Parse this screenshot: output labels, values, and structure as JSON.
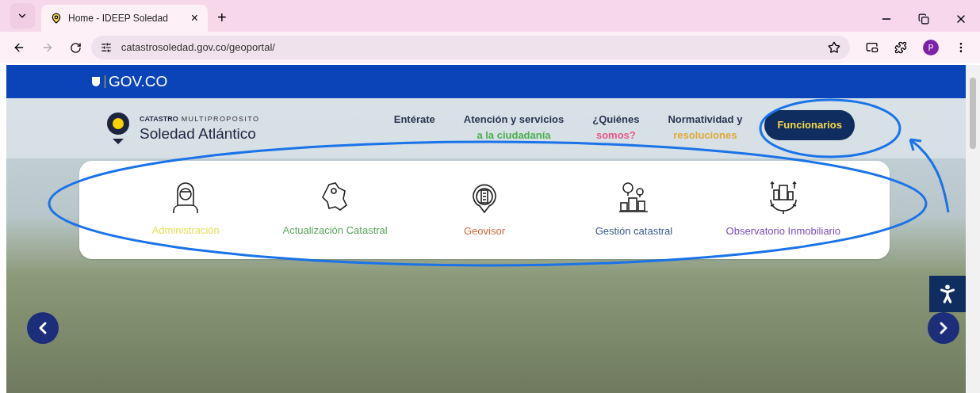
{
  "browser": {
    "tab_title": "Home - IDEEP Soledad",
    "tab_close": "×",
    "new_tab": "+",
    "url": "catastrosoledad.gov.co/geoportal/",
    "profile_initial": "P"
  },
  "gov_bar": {
    "label": "GOV.CO"
  },
  "header": {
    "brand_top_bold": "CATASTRO",
    "brand_top_light": "MULTIPROPOSITO",
    "brand_name": "Soledad Atlántico",
    "nav": [
      {
        "label": "Entérate"
      },
      {
        "label": "Atención y servicios",
        "sublabel": "a la ciudadanía",
        "color": "#4caf50"
      },
      {
        "label": "¿Quiénes",
        "sublabel": "somos?",
        "color": "#e8588a"
      },
      {
        "label": "Normatividad y",
        "sublabel": "resoluciones",
        "color": "#e0a93a"
      }
    ],
    "button": "Funcionarios"
  },
  "menu_card": [
    {
      "label": "Administración",
      "kind": "person",
      "color": "#e6df5a"
    },
    {
      "label": "Actualización Catastral",
      "kind": "map",
      "color": "#5aa55e"
    },
    {
      "label": "Geovisor",
      "kind": "globe",
      "color": "#d4643a"
    },
    {
      "label": "Gestión catastral",
      "kind": "city",
      "color": "#3b5a8a"
    },
    {
      "label": "Observatorio Inmobiliario",
      "kind": "gear",
      "color": "#7b4fc0"
    }
  ]
}
